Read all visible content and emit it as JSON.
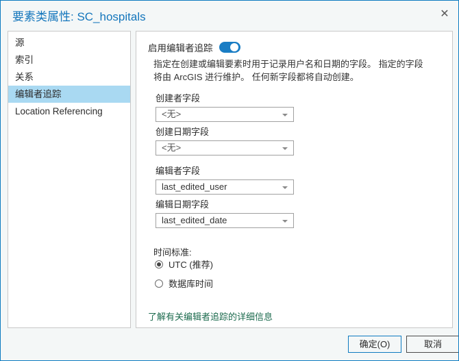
{
  "window": {
    "title": "要素类属性: SC_hospitals",
    "close_label": "✕"
  },
  "sidebar": {
    "items": [
      {
        "label": "源",
        "selected": false
      },
      {
        "label": "索引",
        "selected": false
      },
      {
        "label": "关系",
        "selected": false
      },
      {
        "label": "编辑者追踪",
        "selected": true
      },
      {
        "label": "Location Referencing",
        "selected": false
      }
    ]
  },
  "main": {
    "enable": {
      "label": "启用编辑者追踪",
      "toggle_on": true
    },
    "description": "指定在创建或编辑要素时用于记录用户名和日期的字段。 指定的字段将由 ArcGIS 进行维护。 任何新字段都将自动创建。",
    "fields": [
      {
        "label": "创建者字段",
        "value": "<无>",
        "is_placeholder": true
      },
      {
        "label": "创建日期字段",
        "value": "<无>",
        "is_placeholder": true
      },
      {
        "label": "编辑者字段",
        "value": "last_edited_user",
        "is_placeholder": false
      },
      {
        "label": "编辑日期字段",
        "value": "last_edited_date",
        "is_placeholder": false
      }
    ],
    "time_standard": {
      "title": "时间标准:",
      "options": [
        {
          "label": "UTC (推荐)",
          "selected": true
        },
        {
          "label": "数据库时间",
          "selected": false
        }
      ]
    },
    "help_link": "了解有关编辑者追踪的详细信息"
  },
  "footer": {
    "ok_label": "确定(O)",
    "cancel_label": "取消"
  },
  "colors": {
    "accent": "#0c7ac0",
    "title": "#1476bc",
    "selection": "#a9d9f2",
    "toggle_on": "#1a7dc4",
    "link": "#1c6b4e"
  }
}
